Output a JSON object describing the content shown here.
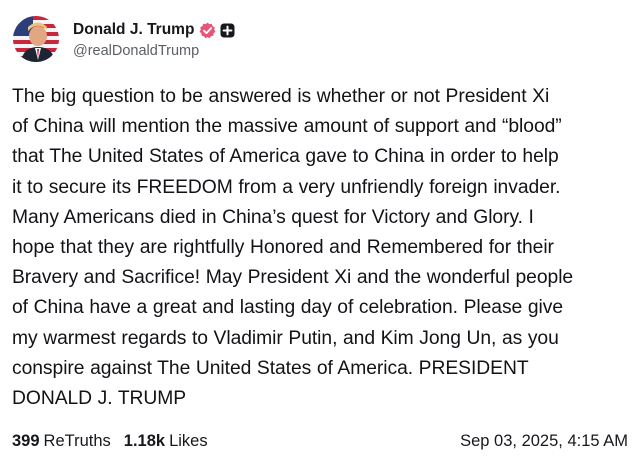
{
  "author": {
    "display_name": "Donald J. Trump",
    "handle": "@realDonaldTrump",
    "verified_badge_color": "#e8557a",
    "avatar": "profile-photo-flag-background"
  },
  "post": {
    "lines": [
      "The big question to be  answered is whether or not President Xi",
      "of China will mention the massive amount of  support and “blood”",
      "that The United States of America gave to China in order to help",
      "it to secure its FREEDOM from a very unfriendly foreign invader.",
      "Many Americans died in China’s quest for Victory and Glory. I",
      "hope that they are rightfully Honored and Remembered for their",
      "Bravery and Sacrifice! May President Xi and the wonderful people",
      "of China have a great and lasting day of celebration. Please give",
      "my warmest regards to Vladimir Putin, and Kim Jong Un, as you",
      "conspire against The United States of America. PRESIDENT",
      "DONALD J. TRUMP"
    ]
  },
  "stats": {
    "retruths_count": "399",
    "retruths_label": "ReTruths",
    "likes_count": "1.18k",
    "likes_label": "Likes"
  },
  "timestamp": "Sep 03, 2025, 4:15 AM"
}
